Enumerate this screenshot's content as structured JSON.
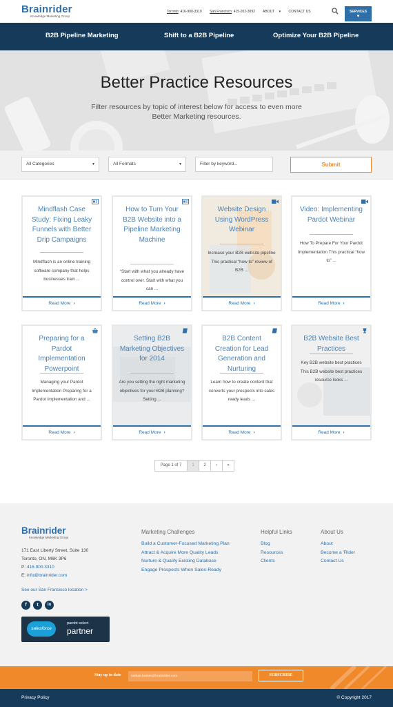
{
  "header": {
    "logo_name": "Brainrider",
    "logo_tag": "Knowledge Marketing Group",
    "toronto_label": "Toronto",
    "toronto_phone": ": 416-900-3310",
    "sf_label": "San Francisco",
    "sf_phone": ": 415-202-3092",
    "about": "ABOUT",
    "contact": "CONTACT US",
    "services": "SERVICES"
  },
  "nav": {
    "items": [
      "B2B Pipeline Marketing",
      "Shift to a B2B Pipeline",
      "Optimize Your B2B Pipeline"
    ]
  },
  "hero": {
    "title": "Better Practice Resources",
    "subtitle": "Filter resources by topic of interest below for access to even more Better Marketing resources."
  },
  "filters": {
    "category": "All Categories",
    "format": "All Formats",
    "keyword_placeholder": "Filter by keyword...",
    "submit": "Submit"
  },
  "cards": [
    {
      "title": "Mindflash Case Study: Fixing Leaky Funnels with Better Drip Campaigns",
      "excerpt": "Mindflash is an online training software company that helps businesses train ...",
      "read_more": "Read More",
      "icon": "case-study-icon"
    },
    {
      "title": "How to Turn Your B2B Website into a Pipeline Marketing Machine",
      "excerpt": "“Start with what you already have control over. Start with what you can ...",
      "read_more": "Read More",
      "icon": "case-study-icon"
    },
    {
      "title": "Website Design Using WordPress Webinar",
      "excerpt": "Increase your B2B website pipeline This practical “how to” review of B2B ...",
      "read_more": "Read More",
      "icon": "video-icon"
    },
    {
      "title": "Video: Implementing Pardot Webinar",
      "excerpt": "How To Prepare For Your Pardot Implementation This practical “how to” ...",
      "read_more": "Read More",
      "icon": "video-icon"
    },
    {
      "title": "Preparing for a Pardot Implementation Powerpoint",
      "excerpt": "Managing your Pardot Implementation Preparing for a Pardot Implementation and ...",
      "read_more": "Read More",
      "icon": "basket-icon"
    },
    {
      "title": "Setting B2B Marketing Objectives for 2014",
      "excerpt": "Are you setting the right marketing objectives for your B2B planning? Setting ...",
      "read_more": "Read More",
      "icon": "book-icon"
    },
    {
      "title": "B2B Content Creation for Lead Generation and Nurturing",
      "excerpt": "Learn how to create content that converts your prospects into sales ready leads ...",
      "read_more": "Read More",
      "icon": "book-icon"
    },
    {
      "title": "B2B Website Best Practices",
      "excerpt": "Key B2B website best practices This B2B website best practices resource looks ...",
      "read_more": "Read More",
      "icon": "trophy-icon"
    }
  ],
  "pagination": {
    "label": "Page 1 of 7",
    "pages": [
      "1",
      "2",
      "›",
      "»"
    ]
  },
  "footer": {
    "logo_name": "Brainrider",
    "logo_tag": "Knowledge Marketing Group",
    "address1": "171 East Liberty Street, Suite 130",
    "address2": "Toronto, ON, M6K 3P6",
    "phone_label": "P: ",
    "phone": "416.900.3310",
    "email_label": "E: ",
    "email": "info@brainrider.com",
    "sf_link": "See our San Francisco location >",
    "social": [
      "f",
      "t",
      "in"
    ],
    "partner_cloud": "salesforce",
    "partner_sub": "pardot select",
    "partner_big": "partner",
    "col1": {
      "heading": "Marketing Challenges",
      "links": [
        "Build a Customer-Focused Marketing Plan",
        "Attract & Acquire More Quality Leads",
        "Nurture & Qualify Existing Database",
        "Engage Prospects When Sales-Ready"
      ]
    },
    "col2": {
      "heading": "Helpful Links",
      "links": [
        "Blog",
        "Resources",
        "Clients"
      ]
    },
    "col3": {
      "heading": "About Us",
      "links": [
        "About",
        "Become a 'Rider",
        "Contact Us"
      ]
    }
  },
  "subscribe": {
    "label": "Stay up to date",
    "email_value": "nathan.homer@brainrider.com",
    "button": "SUBSCRIBE"
  },
  "bottom": {
    "privacy": "Privacy Policy",
    "copyright": "© Copyright 2017"
  },
  "colors": {
    "brand_blue": "#2e6fa7",
    "navy": "#163a5a",
    "orange": "#f0892a"
  }
}
